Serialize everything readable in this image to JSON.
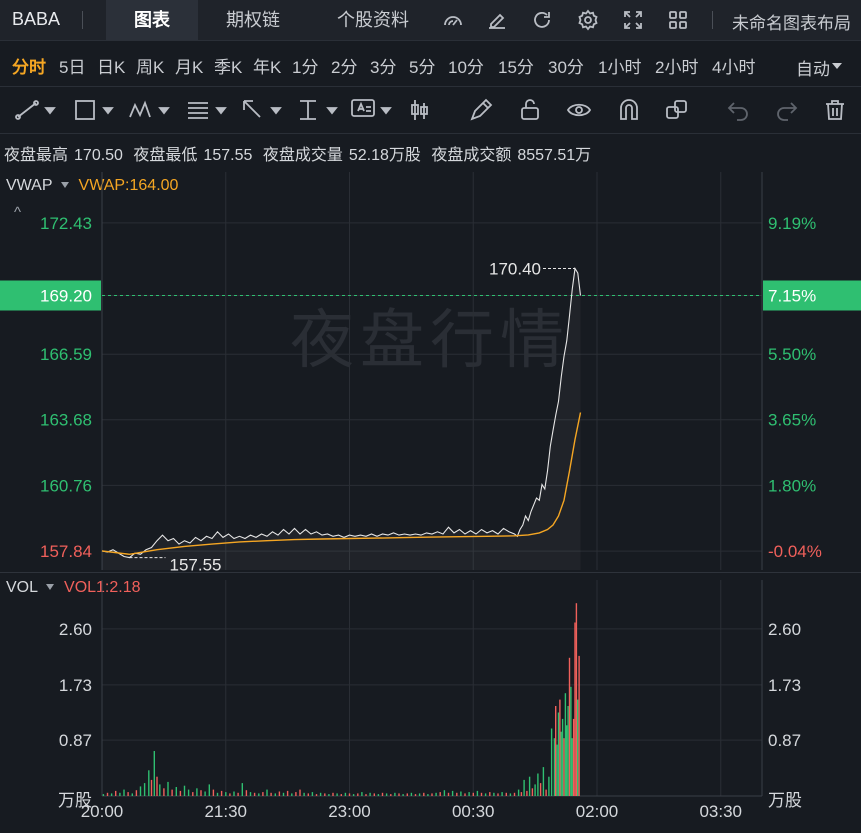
{
  "topbar": {
    "ticker": "BABA",
    "tabs": [
      {
        "label": "图表",
        "active": true
      },
      {
        "label": "期权链",
        "active": false
      },
      {
        "label": "个股资料",
        "active": false
      }
    ],
    "icons": [
      "gauge-icon",
      "edit-icon",
      "refresh-icon",
      "gear-icon",
      "fullscreen-icon",
      "grid-icon"
    ],
    "layout_name": "未命名图表布局"
  },
  "periods": {
    "items": [
      "分时",
      "5日",
      "日K",
      "周K",
      "月K",
      "季K",
      "年K",
      "1分",
      "2分",
      "3分",
      "5分",
      "10分",
      "15分",
      "30分",
      "1小时",
      "2小时",
      "4小时"
    ],
    "active": "分时",
    "mode": "自动"
  },
  "drawing_tools": [
    "line-tool-icon",
    "rect-tool-icon",
    "wave-tool-icon",
    "fib-tool-icon",
    "arrow-tool-icon",
    "text-cursor-tool-icon",
    "text-box-tool-icon",
    "candle-tool-icon",
    "pen-icon",
    "unlock-icon",
    "eye-icon",
    "magnet-icon",
    "clone-icon",
    "undo-icon",
    "redo-icon",
    "trash-icon"
  ],
  "stats": {
    "high_label": "夜盘最高",
    "high_value": "170.50",
    "low_label": "夜盘最低",
    "low_value": "157.55",
    "volume_label": "夜盘成交量",
    "volume_value": "52.18万股",
    "turnover_label": "夜盘成交额",
    "turnover_value": "8557.51万"
  },
  "main_indicator": {
    "name": "VWAP",
    "value_label": "VWAP:164.00",
    "collapse_glyph": "^"
  },
  "vol_indicator": {
    "name": "VOL",
    "value_label": "VOL1:2.18"
  },
  "watermark": "夜盘行情",
  "colors": {
    "up": "#2fbf71",
    "down": "#f0605b",
    "vwap": "#f5a623",
    "price": "#e6e6e6",
    "current_badge": "#2fbf71"
  },
  "chart_data": {
    "type": "line",
    "price_axis": {
      "ticks": [
        172.43,
        169.2,
        166.59,
        163.68,
        160.76,
        157.84
      ],
      "tick_labels": [
        "172.43",
        "169.20",
        "166.59",
        "163.68",
        "160.76",
        "157.84"
      ],
      "pct_labels": [
        "9.19%",
        "7.15%",
        "5.50%",
        "3.65%",
        "1.80%",
        "-0.04%"
      ],
      "ylim": [
        157.0,
        173.8
      ],
      "current_price": 169.2,
      "current_pct": "7.15%",
      "high_annotation": "170.40",
      "low_annotation": "157.55",
      "high_value": 170.4,
      "low_value": 157.55
    },
    "time_axis": {
      "labels": [
        "20:00",
        "21:30",
        "23:00",
        "00:30",
        "02:00",
        "03:30"
      ],
      "xlim_minutes": [
        0,
        480
      ],
      "label_minutes": [
        0,
        90,
        180,
        270,
        360,
        450
      ]
    },
    "price_series": [
      [
        0,
        157.85
      ],
      [
        4,
        157.8
      ],
      [
        8,
        157.9
      ],
      [
        12,
        157.75
      ],
      [
        16,
        157.6
      ],
      [
        20,
        157.55
      ],
      [
        24,
        157.75
      ],
      [
        28,
        157.7
      ],
      [
        32,
        157.9
      ],
      [
        36,
        158.0
      ],
      [
        40,
        158.3
      ],
      [
        44,
        158.55
      ],
      [
        48,
        158.3
      ],
      [
        52,
        158.4
      ],
      [
        56,
        158.15
      ],
      [
        60,
        158.3
      ],
      [
        64,
        158.2
      ],
      [
        68,
        158.45
      ],
      [
        72,
        158.3
      ],
      [
        76,
        158.5
      ],
      [
        80,
        158.4
      ],
      [
        84,
        158.7
      ],
      [
        88,
        158.45
      ],
      [
        92,
        158.6
      ],
      [
        96,
        158.4
      ],
      [
        100,
        158.5
      ],
      [
        104,
        158.4
      ],
      [
        108,
        158.55
      ],
      [
        112,
        158.45
      ],
      [
        116,
        158.6
      ],
      [
        120,
        158.5
      ],
      [
        124,
        158.7
      ],
      [
        128,
        158.55
      ],
      [
        132,
        158.8
      ],
      [
        136,
        158.6
      ],
      [
        140,
        158.85
      ],
      [
        144,
        158.6
      ],
      [
        148,
        158.8
      ],
      [
        152,
        158.6
      ],
      [
        156,
        158.7
      ],
      [
        160,
        158.55
      ],
      [
        164,
        158.6
      ],
      [
        168,
        158.5
      ],
      [
        172,
        158.55
      ],
      [
        176,
        158.45
      ],
      [
        180,
        158.55
      ],
      [
        184,
        158.5
      ],
      [
        188,
        158.55
      ],
      [
        192,
        158.5
      ],
      [
        196,
        158.6
      ],
      [
        200,
        158.5
      ],
      [
        204,
        158.6
      ],
      [
        208,
        158.55
      ],
      [
        212,
        158.65
      ],
      [
        216,
        158.55
      ],
      [
        220,
        158.6
      ],
      [
        224,
        158.55
      ],
      [
        228,
        158.6
      ],
      [
        232,
        158.55
      ],
      [
        236,
        158.65
      ],
      [
        240,
        158.6
      ],
      [
        244,
        158.7
      ],
      [
        248,
        158.6
      ],
      [
        252,
        158.9
      ],
      [
        256,
        158.65
      ],
      [
        260,
        158.8
      ],
      [
        264,
        158.6
      ],
      [
        268,
        158.75
      ],
      [
        272,
        158.6
      ],
      [
        276,
        158.8
      ],
      [
        280,
        158.65
      ],
      [
        284,
        158.75
      ],
      [
        288,
        158.6
      ],
      [
        292,
        158.85
      ],
      [
        296,
        158.7
      ],
      [
        300,
        158.6
      ],
      [
        302,
        158.5
      ],
      [
        304,
        158.8
      ],
      [
        306,
        159.0
      ],
      [
        308,
        159.4
      ],
      [
        310,
        159.2
      ],
      [
        312,
        159.6
      ],
      [
        314,
        159.9
      ],
      [
        316,
        160.2
      ],
      [
        318,
        160.1
      ],
      [
        320,
        160.8
      ],
      [
        322,
        160.6
      ],
      [
        324,
        161.4
      ],
      [
        326,
        162.5
      ],
      [
        328,
        163.2
      ],
      [
        330,
        163.9
      ],
      [
        332,
        164.5
      ],
      [
        334,
        165.6
      ],
      [
        336,
        166.5
      ],
      [
        338,
        167.2
      ],
      [
        340,
        168.3
      ],
      [
        342,
        169.5
      ],
      [
        344,
        170.4
      ],
      [
        346,
        170.2
      ],
      [
        348,
        169.2
      ]
    ],
    "vwap_series": [
      [
        0,
        157.85
      ],
      [
        20,
        157.7
      ],
      [
        40,
        157.9
      ],
      [
        60,
        158.05
      ],
      [
        80,
        158.15
      ],
      [
        100,
        158.25
      ],
      [
        120,
        158.3
      ],
      [
        140,
        158.35
      ],
      [
        160,
        158.38
      ],
      [
        180,
        158.4
      ],
      [
        200,
        158.42
      ],
      [
        220,
        158.44
      ],
      [
        240,
        158.46
      ],
      [
        260,
        158.48
      ],
      [
        280,
        158.5
      ],
      [
        300,
        158.52
      ],
      [
        310,
        158.56
      ],
      [
        318,
        158.65
      ],
      [
        324,
        158.8
      ],
      [
        328,
        159.0
      ],
      [
        332,
        159.4
      ],
      [
        336,
        160.1
      ],
      [
        340,
        161.4
      ],
      [
        344,
        162.8
      ],
      [
        348,
        164.0
      ]
    ],
    "volume_axis": {
      "tick_labels": [
        "2.60",
        "1.73",
        "0.87"
      ],
      "ticks": [
        2.6,
        1.73,
        0.87
      ],
      "ylim": [
        0,
        3.05
      ],
      "unit": "万股"
    },
    "volume_series": [
      [
        1,
        0.03,
        "up"
      ],
      [
        4,
        0.05,
        "down"
      ],
      [
        7,
        0.04,
        "up"
      ],
      [
        10,
        0.08,
        "down"
      ],
      [
        13,
        0.05,
        "up"
      ],
      [
        16,
        0.1,
        "up"
      ],
      [
        19,
        0.06,
        "down"
      ],
      [
        22,
        0.04,
        "up"
      ],
      [
        25,
        0.09,
        "down"
      ],
      [
        28,
        0.15,
        "up"
      ],
      [
        31,
        0.2,
        "up"
      ],
      [
        34,
        0.4,
        "up"
      ],
      [
        36,
        0.25,
        "down"
      ],
      [
        38,
        0.7,
        "up"
      ],
      [
        40,
        0.3,
        "down"
      ],
      [
        42,
        0.18,
        "up"
      ],
      [
        45,
        0.12,
        "down"
      ],
      [
        48,
        0.22,
        "up"
      ],
      [
        51,
        0.1,
        "down"
      ],
      [
        54,
        0.14,
        "up"
      ],
      [
        57,
        0.08,
        "down"
      ],
      [
        60,
        0.16,
        "up"
      ],
      [
        63,
        0.1,
        "up"
      ],
      [
        66,
        0.06,
        "down"
      ],
      [
        69,
        0.12,
        "up"
      ],
      [
        72,
        0.09,
        "down"
      ],
      [
        75,
        0.07,
        "up"
      ],
      [
        78,
        0.18,
        "up"
      ],
      [
        81,
        0.1,
        "down"
      ],
      [
        84,
        0.05,
        "up"
      ],
      [
        87,
        0.08,
        "down"
      ],
      [
        90,
        0.06,
        "up"
      ],
      [
        93,
        0.04,
        "down"
      ],
      [
        96,
        0.07,
        "up"
      ],
      [
        99,
        0.05,
        "down"
      ],
      [
        102,
        0.2,
        "up"
      ],
      [
        105,
        0.09,
        "down"
      ],
      [
        108,
        0.06,
        "up"
      ],
      [
        111,
        0.05,
        "down"
      ],
      [
        114,
        0.04,
        "up"
      ],
      [
        117,
        0.06,
        "down"
      ],
      [
        120,
        0.1,
        "up"
      ],
      [
        123,
        0.05,
        "down"
      ],
      [
        126,
        0.04,
        "up"
      ],
      [
        129,
        0.07,
        "down"
      ],
      [
        132,
        0.05,
        "up"
      ],
      [
        135,
        0.08,
        "down"
      ],
      [
        138,
        0.04,
        "up"
      ],
      [
        141,
        0.06,
        "down"
      ],
      [
        144,
        0.1,
        "down"
      ],
      [
        147,
        0.05,
        "up"
      ],
      [
        150,
        0.04,
        "down"
      ],
      [
        153,
        0.06,
        "up"
      ],
      [
        156,
        0.03,
        "down"
      ],
      [
        159,
        0.05,
        "up"
      ],
      [
        162,
        0.04,
        "down"
      ],
      [
        165,
        0.03,
        "up"
      ],
      [
        168,
        0.05,
        "down"
      ],
      [
        171,
        0.04,
        "up"
      ],
      [
        174,
        0.03,
        "down"
      ],
      [
        177,
        0.05,
        "up"
      ],
      [
        180,
        0.04,
        "down"
      ],
      [
        183,
        0.03,
        "up"
      ],
      [
        186,
        0.04,
        "down"
      ],
      [
        189,
        0.06,
        "up"
      ],
      [
        192,
        0.03,
        "down"
      ],
      [
        195,
        0.05,
        "up"
      ],
      [
        198,
        0.04,
        "down"
      ],
      [
        201,
        0.03,
        "up"
      ],
      [
        204,
        0.05,
        "down"
      ],
      [
        207,
        0.04,
        "up"
      ],
      [
        210,
        0.03,
        "down"
      ],
      [
        213,
        0.05,
        "up"
      ],
      [
        216,
        0.04,
        "down"
      ],
      [
        219,
        0.03,
        "up"
      ],
      [
        222,
        0.04,
        "down"
      ],
      [
        225,
        0.05,
        "up"
      ],
      [
        228,
        0.03,
        "down"
      ],
      [
        231,
        0.04,
        "up"
      ],
      [
        234,
        0.05,
        "down"
      ],
      [
        237,
        0.03,
        "up"
      ],
      [
        240,
        0.04,
        "down"
      ],
      [
        243,
        0.05,
        "up"
      ],
      [
        246,
        0.06,
        "down"
      ],
      [
        249,
        0.09,
        "up"
      ],
      [
        252,
        0.05,
        "down"
      ],
      [
        255,
        0.08,
        "up"
      ],
      [
        258,
        0.05,
        "down"
      ],
      [
        261,
        0.07,
        "up"
      ],
      [
        264,
        0.04,
        "down"
      ],
      [
        267,
        0.06,
        "up"
      ],
      [
        270,
        0.05,
        "down"
      ],
      [
        273,
        0.08,
        "up"
      ],
      [
        276,
        0.05,
        "down"
      ],
      [
        279,
        0.04,
        "up"
      ],
      [
        282,
        0.06,
        "down"
      ],
      [
        285,
        0.05,
        "up"
      ],
      [
        288,
        0.04,
        "down"
      ],
      [
        291,
        0.06,
        "up"
      ],
      [
        294,
        0.05,
        "down"
      ],
      [
        297,
        0.04,
        "up"
      ],
      [
        300,
        0.05,
        "down"
      ],
      [
        303,
        0.1,
        "up"
      ],
      [
        305,
        0.06,
        "down"
      ],
      [
        307,
        0.25,
        "up"
      ],
      [
        309,
        0.08,
        "down"
      ],
      [
        311,
        0.3,
        "up"
      ],
      [
        313,
        0.12,
        "down"
      ],
      [
        315,
        0.18,
        "up"
      ],
      [
        317,
        0.35,
        "up"
      ],
      [
        319,
        0.2,
        "down"
      ],
      [
        321,
        0.45,
        "up"
      ],
      [
        323,
        0.1,
        "down"
      ],
      [
        325,
        0.3,
        "up"
      ],
      [
        327,
        1.05,
        "up"
      ],
      [
        329,
        0.9,
        "up"
      ],
      [
        330,
        1.4,
        "down"
      ],
      [
        331,
        0.8,
        "up"
      ],
      [
        332,
        1.3,
        "up"
      ],
      [
        333,
        1.5,
        "down"
      ],
      [
        334,
        1.0,
        "up"
      ],
      [
        335,
        1.2,
        "up"
      ],
      [
        336,
        0.9,
        "down"
      ],
      [
        337,
        1.6,
        "up"
      ],
      [
        338,
        1.1,
        "up"
      ],
      [
        339,
        1.4,
        "up"
      ],
      [
        340,
        2.15,
        "down"
      ],
      [
        341,
        1.7,
        "up"
      ],
      [
        342,
        0.9,
        "up"
      ],
      [
        343,
        1.2,
        "down"
      ],
      [
        344,
        2.7,
        "down"
      ],
      [
        345,
        3.0,
        "down"
      ],
      [
        346,
        1.5,
        "up"
      ],
      [
        347,
        2.18,
        "down"
      ]
    ]
  }
}
